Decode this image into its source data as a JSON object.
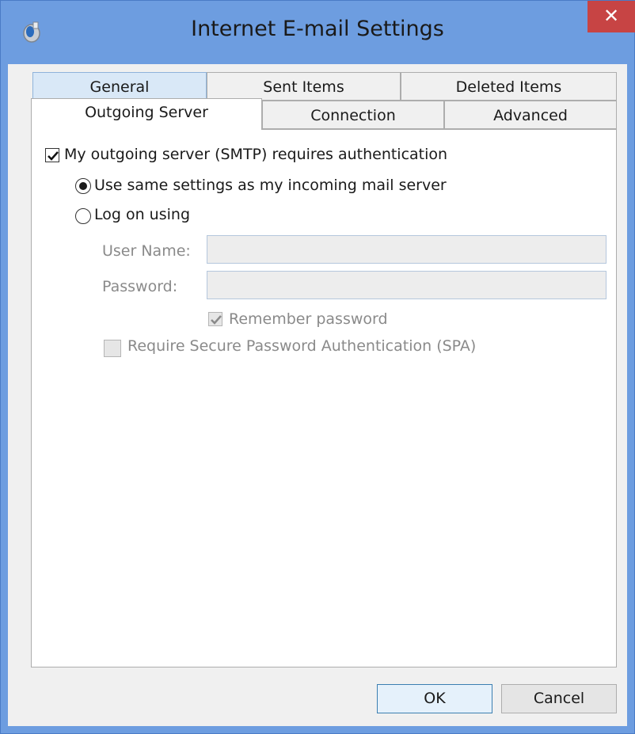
{
  "window": {
    "title": "Internet E-mail Settings",
    "close_label": "✕",
    "accent_color": "#6d9de0",
    "close_color": "#c74444"
  },
  "tabs": {
    "row_back": [
      {
        "label": "General"
      },
      {
        "label": "Sent Items"
      },
      {
        "label": "Deleted Items"
      }
    ],
    "row_front": [
      {
        "label": "Outgoing Server",
        "active": true
      },
      {
        "label": "Connection"
      },
      {
        "label": "Advanced"
      }
    ]
  },
  "outgoing": {
    "smtp_auth_label": "My outgoing server (SMTP) requires authentication",
    "smtp_auth_checked": true,
    "same_settings_label": "Use same settings as my incoming mail server",
    "same_settings_selected": true,
    "logon_label": "Log on using",
    "logon_selected": false,
    "username_label": "User Name:",
    "username_value": "",
    "password_label": "Password:",
    "password_value": "",
    "remember_label": "Remember password",
    "remember_checked": true,
    "spa_label": "Require Secure Password Authentication (SPA)",
    "spa_checked": false
  },
  "buttons": {
    "ok": "OK",
    "cancel": "Cancel"
  }
}
